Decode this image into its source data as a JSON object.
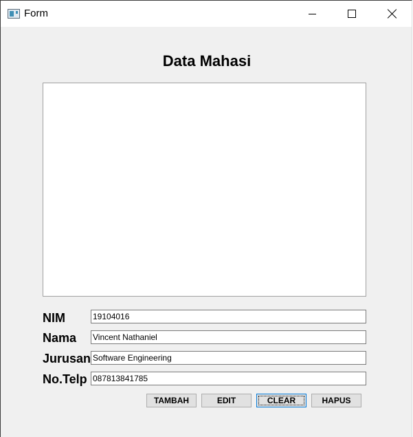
{
  "window": {
    "title": "Form",
    "icon": "window-form-icon"
  },
  "title_controls": {
    "minimize_icon": "minimize-icon",
    "maximize_icon": "maximize-icon",
    "close_icon": "close-icon"
  },
  "heading": "Data Mahasi",
  "fields": {
    "nim": {
      "label": "NIM",
      "value": "19104016"
    },
    "nama": {
      "label": "Nama",
      "value": "Vincent Nathaniel"
    },
    "jurusan": {
      "label": "Jurusan",
      "value": "Software Engineering"
    },
    "telp": {
      "label": "No.Telp",
      "value": "087813841785"
    }
  },
  "buttons": {
    "tambah": "TAMBAH",
    "edit": "EDIT",
    "clear": "CLEAR",
    "hapus": "HAPUS"
  }
}
